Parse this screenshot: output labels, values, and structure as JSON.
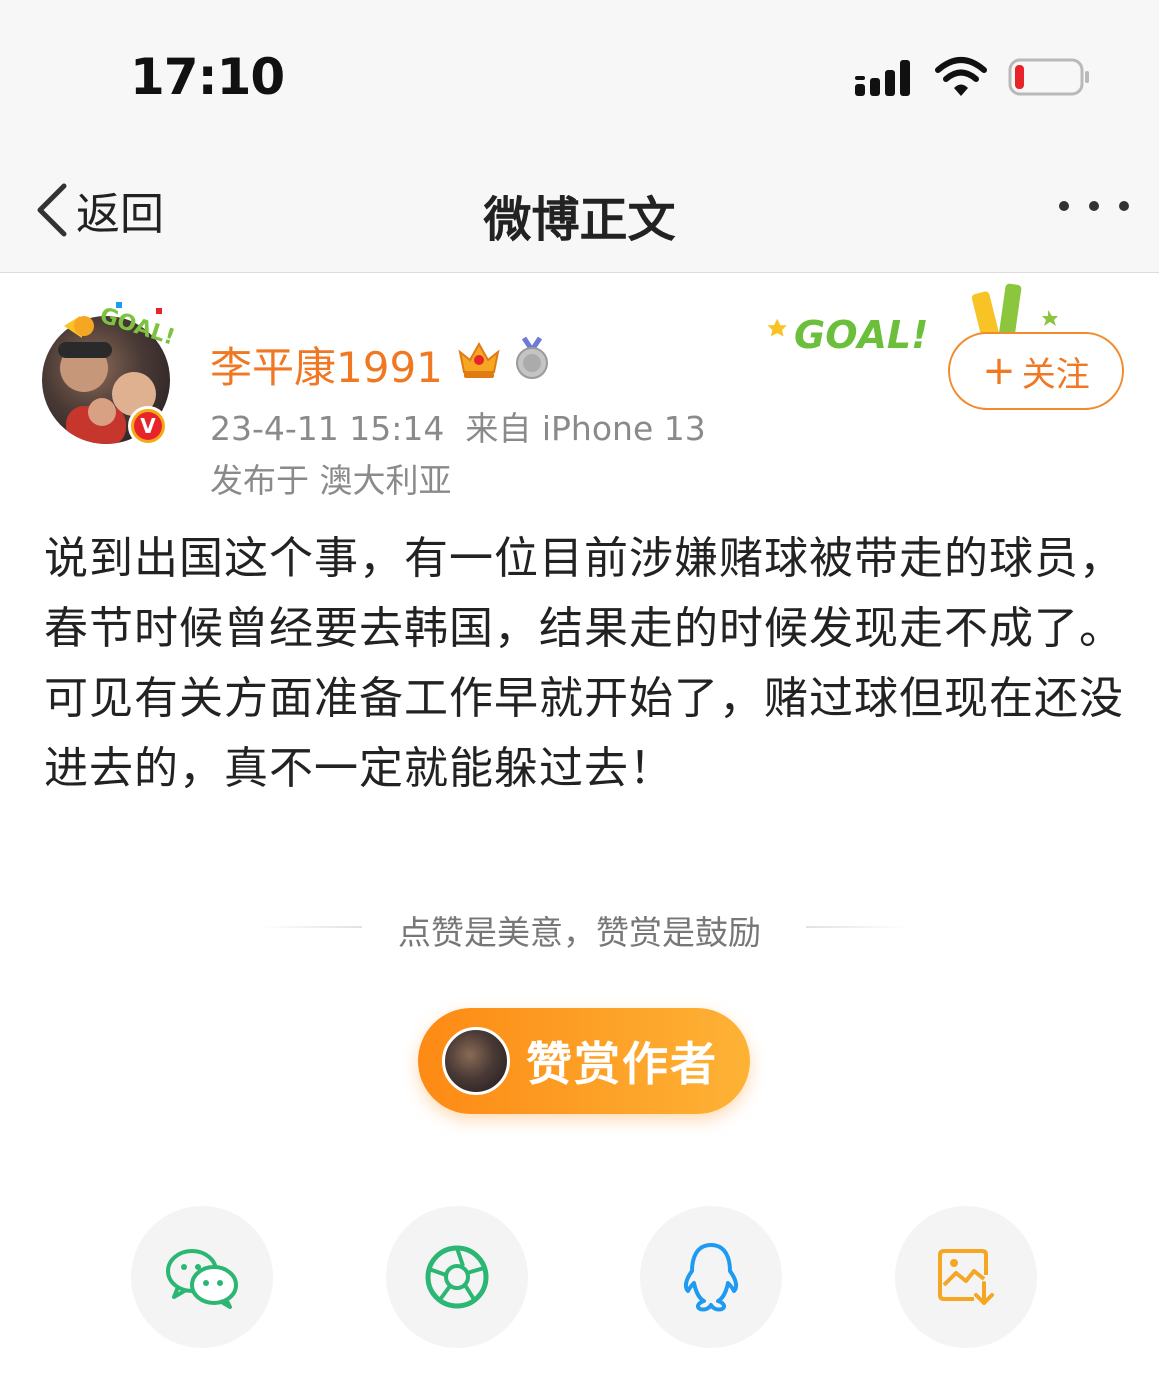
{
  "status_bar": {
    "time": "17:10"
  },
  "nav": {
    "back_label": "返回",
    "title": "微博正文"
  },
  "post": {
    "username": "李平康1991",
    "meta": "23-4-11 15:14  来自 iPhone 13",
    "location": "发布于 澳大利亚",
    "follow_label": "关注",
    "body": "说到出国这个事，有一位目前涉嫌赌球被带走的球员，春节时候曾经要去韩国，结果走的时候发现走不成了。可见有关方面准备工作早就开始了，赌过球但现在还没进去的，真不一定就能躲过去！",
    "avatar_badge": "V",
    "decoration_text": "GOAL!"
  },
  "reward": {
    "tip": "点赞是美意，赞赏是鼓励",
    "button_label": "赞赏作者"
  },
  "share": [
    {
      "icon": "wechat-icon",
      "color": "#2bb673"
    },
    {
      "icon": "moments-icon",
      "color": "#2bb673"
    },
    {
      "icon": "qq-icon",
      "color": "#1e9bf0"
    },
    {
      "icon": "save-image-icon",
      "color": "#f5a623"
    }
  ],
  "colors": {
    "accent": "#f07822",
    "follow_border": "#f28b2c"
  }
}
